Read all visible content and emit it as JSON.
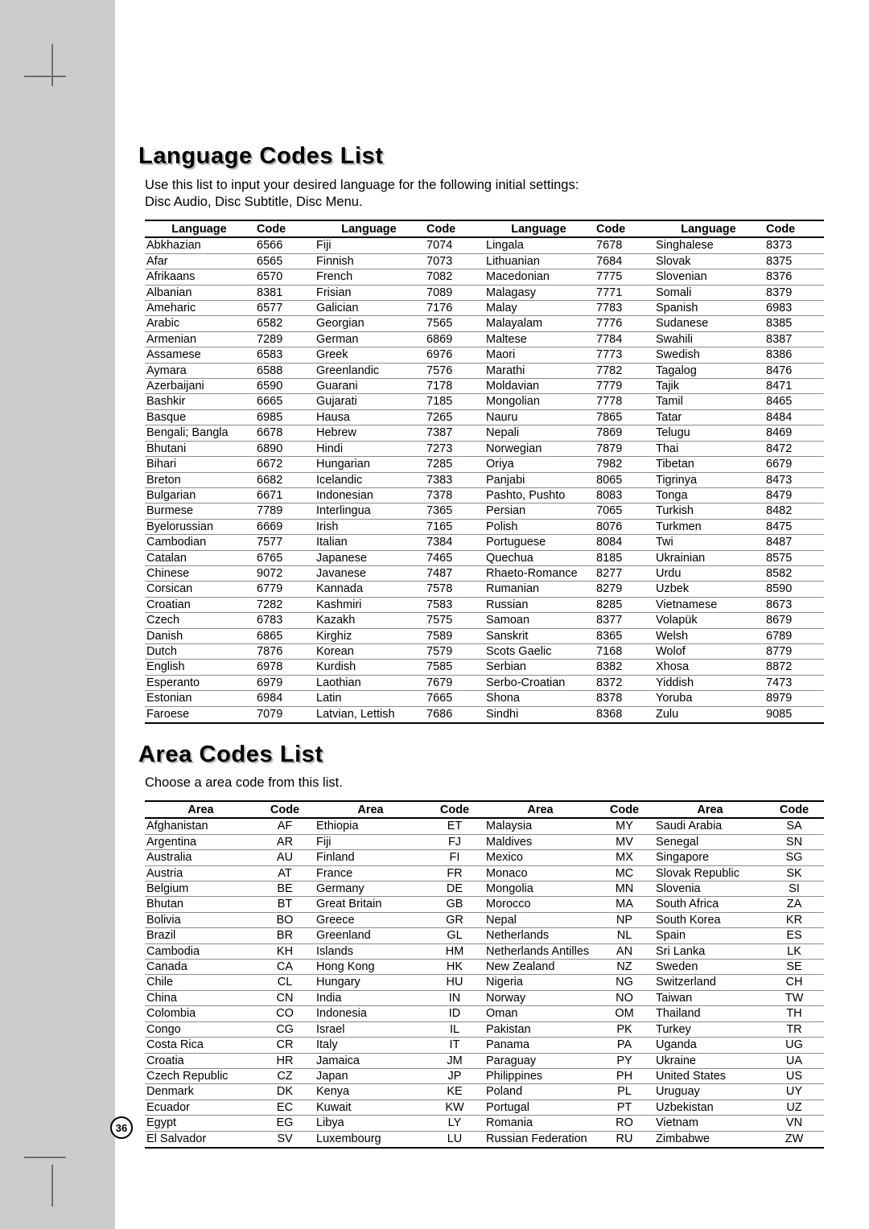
{
  "page": {
    "number": "36"
  },
  "language_section": {
    "title": "Language Codes List",
    "description": "Use this list to input your desired language for the following initial settings:\nDisc Audio, Disc Subtitle, Disc Menu.",
    "headers": {
      "name": "Language",
      "code": "Code"
    },
    "columns": [
      [
        [
          "Abkhazian",
          "6566"
        ],
        [
          "Afar",
          "6565"
        ],
        [
          "Afrikaans",
          "6570"
        ],
        [
          "Albanian",
          "8381"
        ],
        [
          "Ameharic",
          "6577"
        ],
        [
          "Arabic",
          "6582"
        ],
        [
          "Armenian",
          "7289"
        ],
        [
          "Assamese",
          "6583"
        ],
        [
          "Aymara",
          "6588"
        ],
        [
          "Azerbaijani",
          "6590"
        ],
        [
          "Bashkir",
          "6665"
        ],
        [
          "Basque",
          "6985"
        ],
        [
          "Bengali; Bangla",
          "6678"
        ],
        [
          "Bhutani",
          "6890"
        ],
        [
          "Bihari",
          "6672"
        ],
        [
          "Breton",
          "6682"
        ],
        [
          "Bulgarian",
          "6671"
        ],
        [
          "Burmese",
          "7789"
        ],
        [
          "Byelorussian",
          "6669"
        ],
        [
          "Cambodian",
          "7577"
        ],
        [
          "Catalan",
          "6765"
        ],
        [
          "Chinese",
          "9072"
        ],
        [
          "Corsican",
          "6779"
        ],
        [
          "Croatian",
          "7282"
        ],
        [
          "Czech",
          "6783"
        ],
        [
          "Danish",
          "6865"
        ],
        [
          "Dutch",
          "7876"
        ],
        [
          "English",
          "6978"
        ],
        [
          "Esperanto",
          "6979"
        ],
        [
          "Estonian",
          "6984"
        ],
        [
          "Faroese",
          "7079"
        ]
      ],
      [
        [
          "Fiji",
          "7074"
        ],
        [
          "Finnish",
          "7073"
        ],
        [
          "French",
          "7082"
        ],
        [
          "Frisian",
          "7089"
        ],
        [
          "Galician",
          "7176"
        ],
        [
          "Georgian",
          "7565"
        ],
        [
          "German",
          "6869"
        ],
        [
          "Greek",
          "6976"
        ],
        [
          "Greenlandic",
          "7576"
        ],
        [
          "Guarani",
          "7178"
        ],
        [
          "Gujarati",
          "7185"
        ],
        [
          "Hausa",
          "7265"
        ],
        [
          "Hebrew",
          "7387"
        ],
        [
          "Hindi",
          "7273"
        ],
        [
          "Hungarian",
          "7285"
        ],
        [
          "Icelandic",
          "7383"
        ],
        [
          "Indonesian",
          "7378"
        ],
        [
          "Interlingua",
          "7365"
        ],
        [
          "Irish",
          "7165"
        ],
        [
          "Italian",
          "7384"
        ],
        [
          "Japanese",
          "7465"
        ],
        [
          "Javanese",
          "7487"
        ],
        [
          "Kannada",
          "7578"
        ],
        [
          "Kashmiri",
          "7583"
        ],
        [
          "Kazakh",
          "7575"
        ],
        [
          "Kirghiz",
          "7589"
        ],
        [
          "Korean",
          "7579"
        ],
        [
          "Kurdish",
          "7585"
        ],
        [
          "Laothian",
          "7679"
        ],
        [
          "Latin",
          "7665"
        ],
        [
          "Latvian, Lettish",
          "7686"
        ]
      ],
      [
        [
          "Lingala",
          "7678"
        ],
        [
          "Lithuanian",
          "7684"
        ],
        [
          "Macedonian",
          "7775"
        ],
        [
          "Malagasy",
          "7771"
        ],
        [
          "Malay",
          "7783"
        ],
        [
          "Malayalam",
          "7776"
        ],
        [
          "Maltese",
          "7784"
        ],
        [
          "Maori",
          "7773"
        ],
        [
          "Marathi",
          "7782"
        ],
        [
          "Moldavian",
          "7779"
        ],
        [
          "Mongolian",
          "7778"
        ],
        [
          "Nauru",
          "7865"
        ],
        [
          "Nepali",
          "7869"
        ],
        [
          "Norwegian",
          "7879"
        ],
        [
          "Oriya",
          "7982"
        ],
        [
          "Panjabi",
          "8065"
        ],
        [
          "Pashto, Pushto",
          "8083"
        ],
        [
          "Persian",
          "7065"
        ],
        [
          "Polish",
          "8076"
        ],
        [
          "Portuguese",
          "8084"
        ],
        [
          "Quechua",
          "8185"
        ],
        [
          "Rhaeto-Romance",
          "8277"
        ],
        [
          "Rumanian",
          "8279"
        ],
        [
          "Russian",
          "8285"
        ],
        [
          "Samoan",
          "8377"
        ],
        [
          "Sanskrit",
          "8365"
        ],
        [
          "Scots Gaelic",
          "7168"
        ],
        [
          "Serbian",
          "8382"
        ],
        [
          "Serbo-Croatian",
          "8372"
        ],
        [
          "Shona",
          "8378"
        ],
        [
          "Sindhi",
          "8368"
        ]
      ],
      [
        [
          "Singhalese",
          "8373"
        ],
        [
          "Slovak",
          "8375"
        ],
        [
          "Slovenian",
          "8376"
        ],
        [
          "Somali",
          "8379"
        ],
        [
          "Spanish",
          "6983"
        ],
        [
          "Sudanese",
          "8385"
        ],
        [
          "Swahili",
          "8387"
        ],
        [
          "Swedish",
          "8386"
        ],
        [
          "Tagalog",
          "8476"
        ],
        [
          "Tajik",
          "8471"
        ],
        [
          "Tamil",
          "8465"
        ],
        [
          "Tatar",
          "8484"
        ],
        [
          "Telugu",
          "8469"
        ],
        [
          "Thai",
          "8472"
        ],
        [
          "Tibetan",
          "6679"
        ],
        [
          "Tigrinya",
          "8473"
        ],
        [
          "Tonga",
          "8479"
        ],
        [
          "Turkish",
          "8482"
        ],
        [
          "Turkmen",
          "8475"
        ],
        [
          "Twi",
          "8487"
        ],
        [
          "Ukrainian",
          "8575"
        ],
        [
          "Urdu",
          "8582"
        ],
        [
          "Uzbek",
          "8590"
        ],
        [
          "Vietnamese",
          "8673"
        ],
        [
          "Volapük",
          "8679"
        ],
        [
          "Welsh",
          "6789"
        ],
        [
          "Wolof",
          "8779"
        ],
        [
          "Xhosa",
          "8872"
        ],
        [
          "Yiddish",
          "7473"
        ],
        [
          "Yoruba",
          "8979"
        ],
        [
          "Zulu",
          "9085"
        ]
      ]
    ]
  },
  "area_section": {
    "title": "Area Codes List",
    "description": "Choose a area code from this list.",
    "headers": {
      "name": "Area",
      "code": "Code"
    },
    "columns": [
      [
        [
          "Afghanistan",
          "AF"
        ],
        [
          "Argentina",
          "AR"
        ],
        [
          "Australia",
          "AU"
        ],
        [
          "Austria",
          "AT"
        ],
        [
          "Belgium",
          "BE"
        ],
        [
          "Bhutan",
          "BT"
        ],
        [
          "Bolivia",
          "BO"
        ],
        [
          "Brazil",
          "BR"
        ],
        [
          "Cambodia",
          "KH"
        ],
        [
          "Canada",
          "CA"
        ],
        [
          "Chile",
          "CL"
        ],
        [
          "China",
          "CN"
        ],
        [
          "Colombia",
          "CO"
        ],
        [
          "Congo",
          "CG"
        ],
        [
          "Costa Rica",
          "CR"
        ],
        [
          "Croatia",
          "HR"
        ],
        [
          "Czech Republic",
          "CZ"
        ],
        [
          "Denmark",
          "DK"
        ],
        [
          "Ecuador",
          "EC"
        ],
        [
          "Egypt",
          "EG"
        ],
        [
          "El Salvador",
          "SV"
        ]
      ],
      [
        [
          "Ethiopia",
          "ET"
        ],
        [
          "Fiji",
          "FJ"
        ],
        [
          "Finland",
          "FI"
        ],
        [
          "France",
          "FR"
        ],
        [
          "Germany",
          "DE"
        ],
        [
          "Great Britain",
          "GB"
        ],
        [
          "Greece",
          "GR"
        ],
        [
          "Greenland",
          "GL"
        ],
        [
          "Islands",
          "HM"
        ],
        [
          "Hong Kong",
          "HK"
        ],
        [
          "Hungary",
          "HU"
        ],
        [
          "India",
          "IN"
        ],
        [
          "Indonesia",
          "ID"
        ],
        [
          "Israel",
          "IL"
        ],
        [
          "Italy",
          "IT"
        ],
        [
          "Jamaica",
          "JM"
        ],
        [
          "Japan",
          "JP"
        ],
        [
          "Kenya",
          "KE"
        ],
        [
          "Kuwait",
          "KW"
        ],
        [
          "Libya",
          "LY"
        ],
        [
          "Luxembourg",
          "LU"
        ]
      ],
      [
        [
          "Malaysia",
          "MY"
        ],
        [
          "Maldives",
          "MV"
        ],
        [
          "Mexico",
          "MX"
        ],
        [
          "Monaco",
          "MC"
        ],
        [
          "Mongolia",
          "MN"
        ],
        [
          "Morocco",
          "MA"
        ],
        [
          "Nepal",
          "NP"
        ],
        [
          "Netherlands",
          "NL"
        ],
        [
          "Netherlands Antilles",
          "AN"
        ],
        [
          "New Zealand",
          "NZ"
        ],
        [
          "Nigeria",
          "NG"
        ],
        [
          "Norway",
          "NO"
        ],
        [
          "Oman",
          "OM"
        ],
        [
          "Pakistan",
          "PK"
        ],
        [
          "Panama",
          "PA"
        ],
        [
          "Paraguay",
          "PY"
        ],
        [
          "Philippines",
          "PH"
        ],
        [
          "Poland",
          "PL"
        ],
        [
          "Portugal",
          "PT"
        ],
        [
          "Romania",
          "RO"
        ],
        [
          "Russian Federation",
          "RU"
        ]
      ],
      [
        [
          "Saudi Arabia",
          "SA"
        ],
        [
          "Senegal",
          "SN"
        ],
        [
          "Singapore",
          "SG"
        ],
        [
          "Slovak Republic",
          "SK"
        ],
        [
          "Slovenia",
          "SI"
        ],
        [
          "South Africa",
          "ZA"
        ],
        [
          "South Korea",
          "KR"
        ],
        [
          "Spain",
          "ES"
        ],
        [
          "Sri Lanka",
          "LK"
        ],
        [
          "Sweden",
          "SE"
        ],
        [
          "Switzerland",
          "CH"
        ],
        [
          "Taiwan",
          "TW"
        ],
        [
          "Thailand",
          "TH"
        ],
        [
          "Turkey",
          "TR"
        ],
        [
          "Uganda",
          "UG"
        ],
        [
          "Ukraine",
          "UA"
        ],
        [
          "United States",
          "US"
        ],
        [
          "Uruguay",
          "UY"
        ],
        [
          "Uzbekistan",
          "UZ"
        ],
        [
          "Vietnam",
          "VN"
        ],
        [
          "Zimbabwe",
          "ZW"
        ]
      ]
    ]
  }
}
